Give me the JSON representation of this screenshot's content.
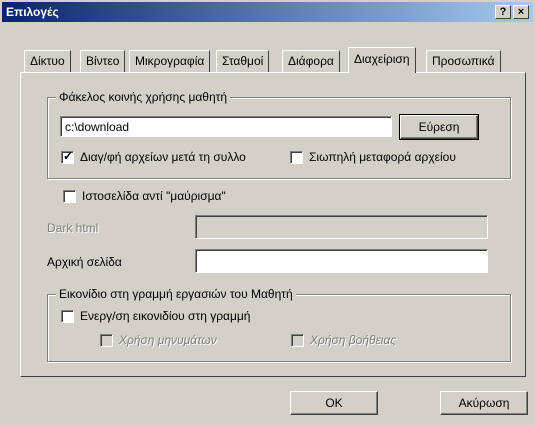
{
  "window": {
    "title": "Επιλογές",
    "help_label": "?",
    "close_label": "×"
  },
  "tabs": [
    {
      "label": "Δίκτυο"
    },
    {
      "label": "Βίντεο"
    },
    {
      "label": "Μικρογραφία"
    },
    {
      "label": "Σταθμοί"
    },
    {
      "label": "Διάφορα"
    },
    {
      "label": "Διαχείριση",
      "active": true
    },
    {
      "label": "Προσωπικά"
    }
  ],
  "shared_folder": {
    "group_label": "Φάκελος κοινής χρήσης μαθητή",
    "path_value": "c:\\download",
    "browse_label": "Εύρεση",
    "copy_files_label": "Διαγ/φή αρχείων μετά τη συλλο",
    "copy_files_checked": true,
    "silent_transfer_label": "Σιωπηλή μεταφορά αρχείου",
    "silent_transfer_checked": false
  },
  "webpage": {
    "instead_of_black_label": "Ιστοσελίδα αντί \"μαύρισμα\"",
    "instead_of_black_checked": false,
    "dark_html_label": "Dark html",
    "dark_html_value": "",
    "home_page_label": "Αρχική σελίδα",
    "home_page_value": ""
  },
  "tray_icon": {
    "group_label": "Εικονίδιο στη γραμμή εργασιών του Μαθητή",
    "enable_label": "Ενεργ/ση εικονιδίου στη γραμμή",
    "enable_checked": false,
    "use_messages_label": "Χρήση μηνυμάτων",
    "use_help_label": "Χρήση βοήθειας"
  },
  "footer": {
    "ok_label": "OK",
    "cancel_label": "Ακύρωση"
  }
}
